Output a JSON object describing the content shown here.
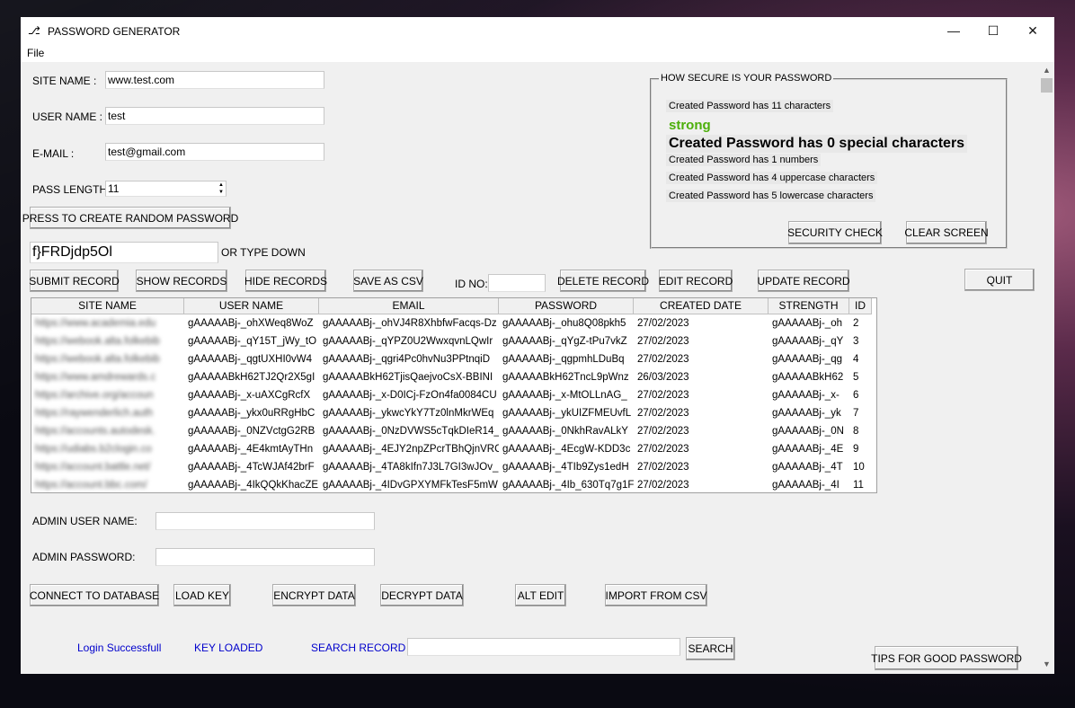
{
  "window": {
    "title": "PASSWORD GENERATOR",
    "title_icon": "⎇",
    "menu_file": "File",
    "minimize_icon": "—",
    "maximize_icon": "☐",
    "close_icon": "✕"
  },
  "form": {
    "site_name_label": "SITE NAME   :",
    "site_name_value": "www.test.com",
    "user_name_label": "USER NAME :",
    "user_name_value": "test",
    "email_label": "E-MAIL      :",
    "email_value": "test@gmail.com",
    "pass_length_label": "PASS LENGTH :",
    "pass_length_value": "11",
    "create_random_button": "PRESS TO CREATE RANDOM PASSWORD",
    "password_value": "f}FRDjdp5Ol",
    "or_type_down": "OR TYPE DOWN"
  },
  "security": {
    "group_title": "HOW SECURE IS YOUR PASSWORD",
    "line_chars": "Created Password has 11   characters",
    "strength": "strong",
    "strength_color": "#4caf0a",
    "line_special": "Created Password has 0 special characters",
    "line_numbers": "Created Password has 1 numbers",
    "line_upper": "Created Password has 4 uppercase characters",
    "line_lower": "Created Password has 5 lowercase characters",
    "security_check_button": "SECURITY CHECK",
    "clear_screen_button": "CLEAR SCREEN"
  },
  "toolbar": {
    "submit": "SUBMIT RECORD",
    "show": "SHOW RECORDS",
    "hide": "HIDE RECORDS",
    "save_csv": "SAVE AS CSV",
    "id_no_label": "ID NO:",
    "id_no_value": "",
    "delete": "DELETE RECORD",
    "edit": "EDIT RECORD",
    "update": "UPDATE RECORD",
    "quit": "QUIT"
  },
  "table": {
    "columns": [
      "SITE NAME",
      "USER NAME",
      "EMAIL",
      "PASSWORD",
      "CREATED DATE",
      "STRENGTH",
      "ID"
    ],
    "rows": [
      [
        "https://www.academia.edu",
        "gAAAAABj-_ohXWeq8WoZ",
        "gAAAAABj-_ohVJ4R8XhbfwFacqs-Dz",
        "gAAAAABj-_ohu8Q08pkh5",
        "27/02/2023",
        "gAAAAABj-_oh",
        "2"
      ],
      [
        "https://webook.alta.folkebib",
        "gAAAAABj-_qY15T_jWy_tO",
        "gAAAAABj-_qYPZ0U2WwxqvnLQwIr",
        "gAAAAABj-_qYgZ-tPu7vkZ",
        "27/02/2023",
        "gAAAAABj-_qY",
        "3"
      ],
      [
        "https://webook.alta.folkebib",
        "gAAAAABj-_qgtUXHI0vW4",
        "gAAAAABj-_qgri4Pc0hvNu3PPtnqiD",
        "gAAAAABj-_qgpmhLDuBq",
        "27/02/2023",
        "gAAAAABj-_qg",
        "4"
      ],
      [
        "https://www.amdrewards.c",
        "gAAAAABkH62TJ2Qr2X5gI",
        "gAAAAABkH62TjisQaejvoCsX-BBINI",
        "gAAAAABkH62TncL9pWnz",
        "26/03/2023",
        "gAAAAABkH62",
        "5"
      ],
      [
        "https://archive.org/accoun",
        "gAAAAABj-_x-uAXCgRcfX",
        "gAAAAABj-_x-D0ICj-FzOn4fa0084CU",
        "gAAAAABj-_x-MtOLLnAG_",
        "27/02/2023",
        "gAAAAABj-_x-",
        "6"
      ],
      [
        "https://raywenderlich.auth",
        "gAAAAABj-_ykx0uRRgHbC",
        "gAAAAABj-_ykwcYkY7Tz0lnMkrWEq",
        "gAAAAABj-_ykUIZFMEUvfL",
        "27/02/2023",
        "gAAAAABj-_yk",
        "7"
      ],
      [
        "https://accounts.autodesk.",
        "gAAAAABj-_0NZVctgG2RB",
        "gAAAAABj-_0NzDVWS5cTqkDIeR14_",
        "gAAAAABj-_0NkhRavALkY",
        "27/02/2023",
        "gAAAAABj-_0N",
        "8"
      ],
      [
        "https://udiabs.b2clogin.co",
        "gAAAAABj-_4E4kmtAyTHn",
        "gAAAAABj-_4EJY2npZPcrTBhQjnVRC",
        "gAAAAABj-_4EcgW-KDD3c",
        "27/02/2023",
        "gAAAAABj-_4E",
        "9"
      ],
      [
        "https://account.battle.net/",
        "gAAAAABj-_4TcWJAf42brF",
        "gAAAAABj-_4TA8kIfn7J3L7GI3wJOv_",
        "gAAAAABj-_4TIb9Zys1edH",
        "27/02/2023",
        "gAAAAABj-_4T",
        "10"
      ],
      [
        "https://account.bbc.com/",
        "gAAAAABj-_4IkQQkKhacZE",
        "gAAAAABj-_4IDvGPXYMFkTesF5mW",
        "gAAAAABj-_4Ib_630Tq7g1F",
        "27/02/2023",
        "gAAAAABj-_4I",
        "11"
      ]
    ]
  },
  "admin": {
    "user_label": "ADMIN USER NAME:",
    "user_value": "",
    "password_label": "ADMIN PASSWORD:",
    "password_value": ""
  },
  "actions": {
    "connect_db": "CONNECT TO DATABASE",
    "load_key": "LOAD KEY",
    "encrypt": "ENCRYPT DATA",
    "decrypt": "DECRYPT DATA",
    "alt_edit": "ALT EDIT",
    "import_csv": "IMPORT FROM CSV"
  },
  "status": {
    "login": "Login Successfull",
    "key": "KEY LOADED",
    "search_label": "SEARCH RECORD :",
    "search_value": "",
    "search_button": "SEARCH",
    "tips_button": "TIPS FOR GOOD PASSWORD"
  }
}
